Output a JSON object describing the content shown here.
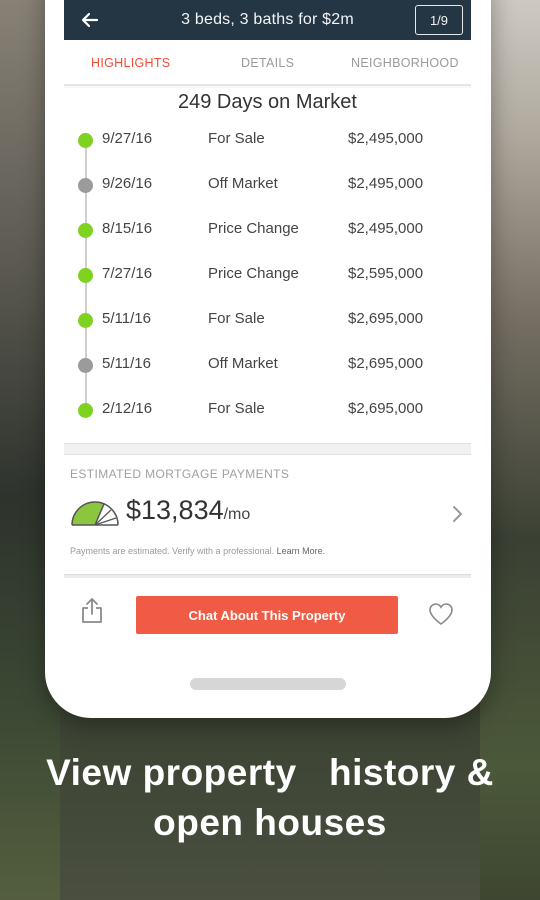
{
  "topbar": {
    "title": "3 beds, 3 baths for $2m",
    "page_counter": "1/9",
    "back_icon": "arrow-left-icon"
  },
  "tabs": [
    {
      "label": "HIGHLIGHTS",
      "active": true
    },
    {
      "label": "DETAILS",
      "active": false
    },
    {
      "label": "NEIGHBORHOOD",
      "active": false
    }
  ],
  "history": {
    "heading": "249 Days on Market",
    "rows": [
      {
        "date": "9/27/16",
        "event": "For Sale",
        "price": "$2,495,000",
        "status_color": "#7ed321"
      },
      {
        "date": "9/26/16",
        "event": "Off Market",
        "price": "$2,495,000",
        "status_color": "#9b9b9b"
      },
      {
        "date": "8/15/16",
        "event": "Price Change",
        "price": "$2,495,000",
        "status_color": "#7ed321"
      },
      {
        "date": "7/27/16",
        "event": "Price Change",
        "price": "$2,595,000",
        "status_color": "#7ed321"
      },
      {
        "date": "5/11/16",
        "event": "For Sale",
        "price": "$2,695,000",
        "status_color": "#7ed321"
      },
      {
        "date": "5/11/16",
        "event": "Off Market",
        "price": "$2,695,000",
        "status_color": "#9b9b9b"
      },
      {
        "date": "2/12/16",
        "event": "For Sale",
        "price": "$2,695,000",
        "status_color": "#7ed321"
      }
    ]
  },
  "mortgage": {
    "label": "ESTIMATED MORTGAGE PAYMENTS",
    "amount": "$13,834",
    "unit": "/mo",
    "disclaimer": "Payments are estimated. Verify with a professional.",
    "learn_more": "Learn More.",
    "gauge_icon": "gauge-icon",
    "chevron_icon": "chevron-right-icon"
  },
  "actions": {
    "share_icon": "share-icon",
    "chat_label": "Chat About This Property",
    "favorite_icon": "heart-icon"
  },
  "caption": {
    "line1": "View property   history &",
    "line2": "open houses"
  },
  "colors": {
    "accent": "#ef5b45",
    "topbar": "#243544",
    "status_active": "#7ed321",
    "status_inactive": "#9b9b9b"
  }
}
